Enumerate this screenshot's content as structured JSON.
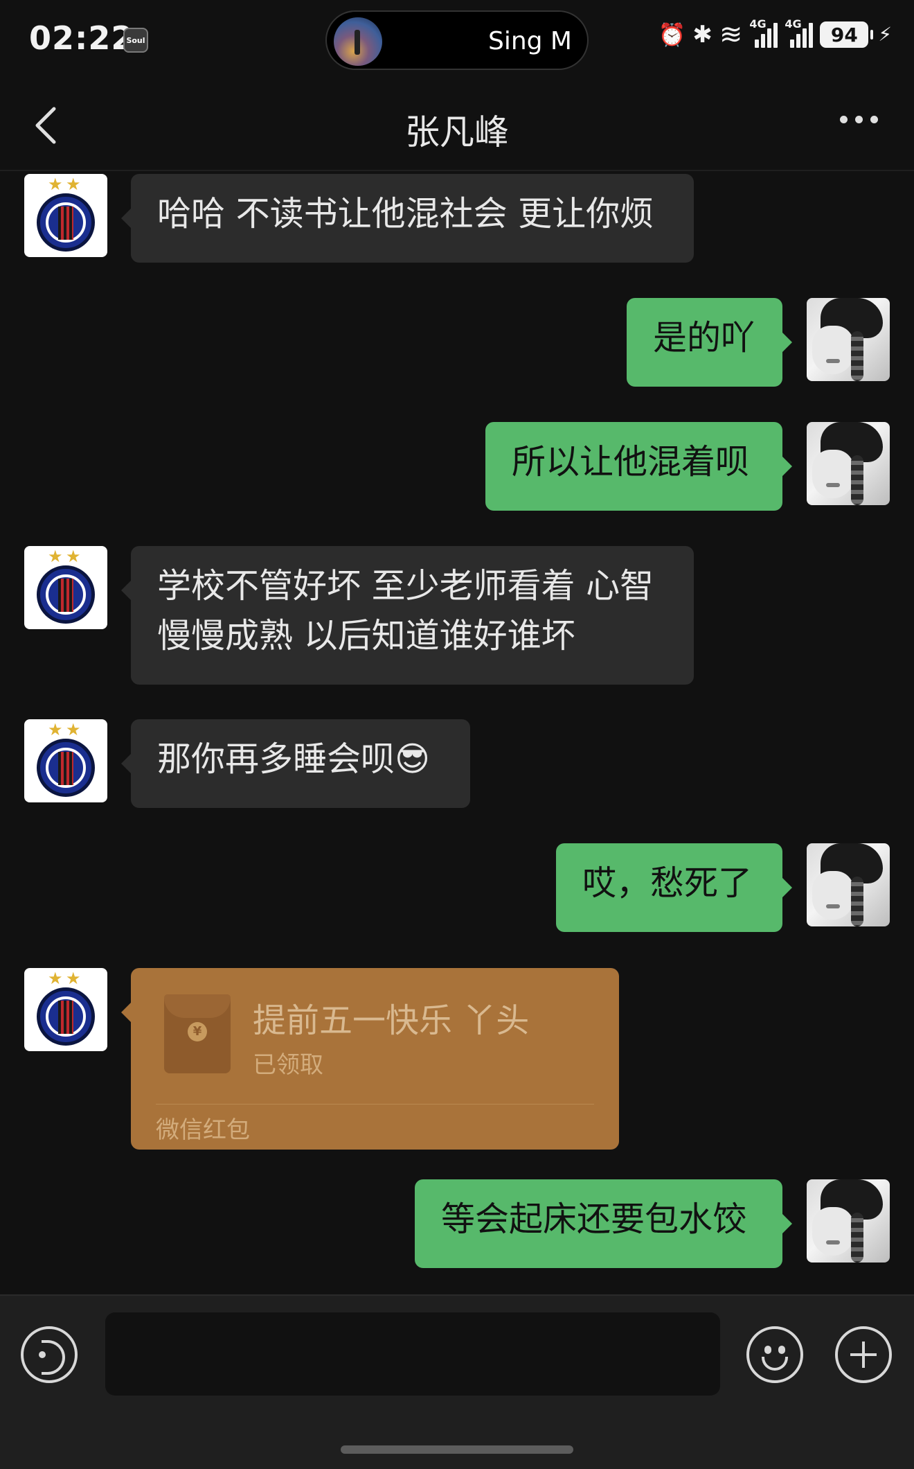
{
  "status_bar": {
    "time": "02:22",
    "app_badge": "Soul",
    "island_text": "Sing M",
    "alarm": "⏰",
    "bluetooth": "✱",
    "wifi": "≋",
    "network_1": "4G",
    "network_2": "4G",
    "battery": "94",
    "charging": "⚡"
  },
  "header": {
    "title": "张凡峰"
  },
  "messages": [
    {
      "side": "left",
      "text": "哈哈 不读书让他混社会 更让你烦"
    },
    {
      "side": "right",
      "text": "是的吖"
    },
    {
      "side": "right",
      "text": "所以让他混着呗"
    },
    {
      "side": "left",
      "text_lines": [
        "学校不管好坏 至少老师看着 心智",
        "慢慢成熟 以后知道谁好谁坏"
      ]
    },
    {
      "side": "left",
      "text": "那你再多睡会呗",
      "emoji": "😎"
    },
    {
      "side": "right",
      "text": "哎，愁死了"
    },
    {
      "side": "left",
      "type": "red_packet",
      "title": "提前五一快乐 丫头",
      "status": "已领取",
      "footer": "微信红包"
    },
    {
      "side": "right",
      "text": "等会起床还要包水饺"
    }
  ],
  "input": {
    "placeholder": "",
    "value": ""
  },
  "colors": {
    "background": "#111111",
    "bubble_left": "#2c2c2c",
    "bubble_right": "#57b96b",
    "red_packet": "#a9733a"
  },
  "icons": {
    "back": "back-chevron-icon",
    "more": "more-dots-icon",
    "voice": "voice-icon",
    "emoji": "emoji-icon",
    "plus": "plus-icon"
  }
}
